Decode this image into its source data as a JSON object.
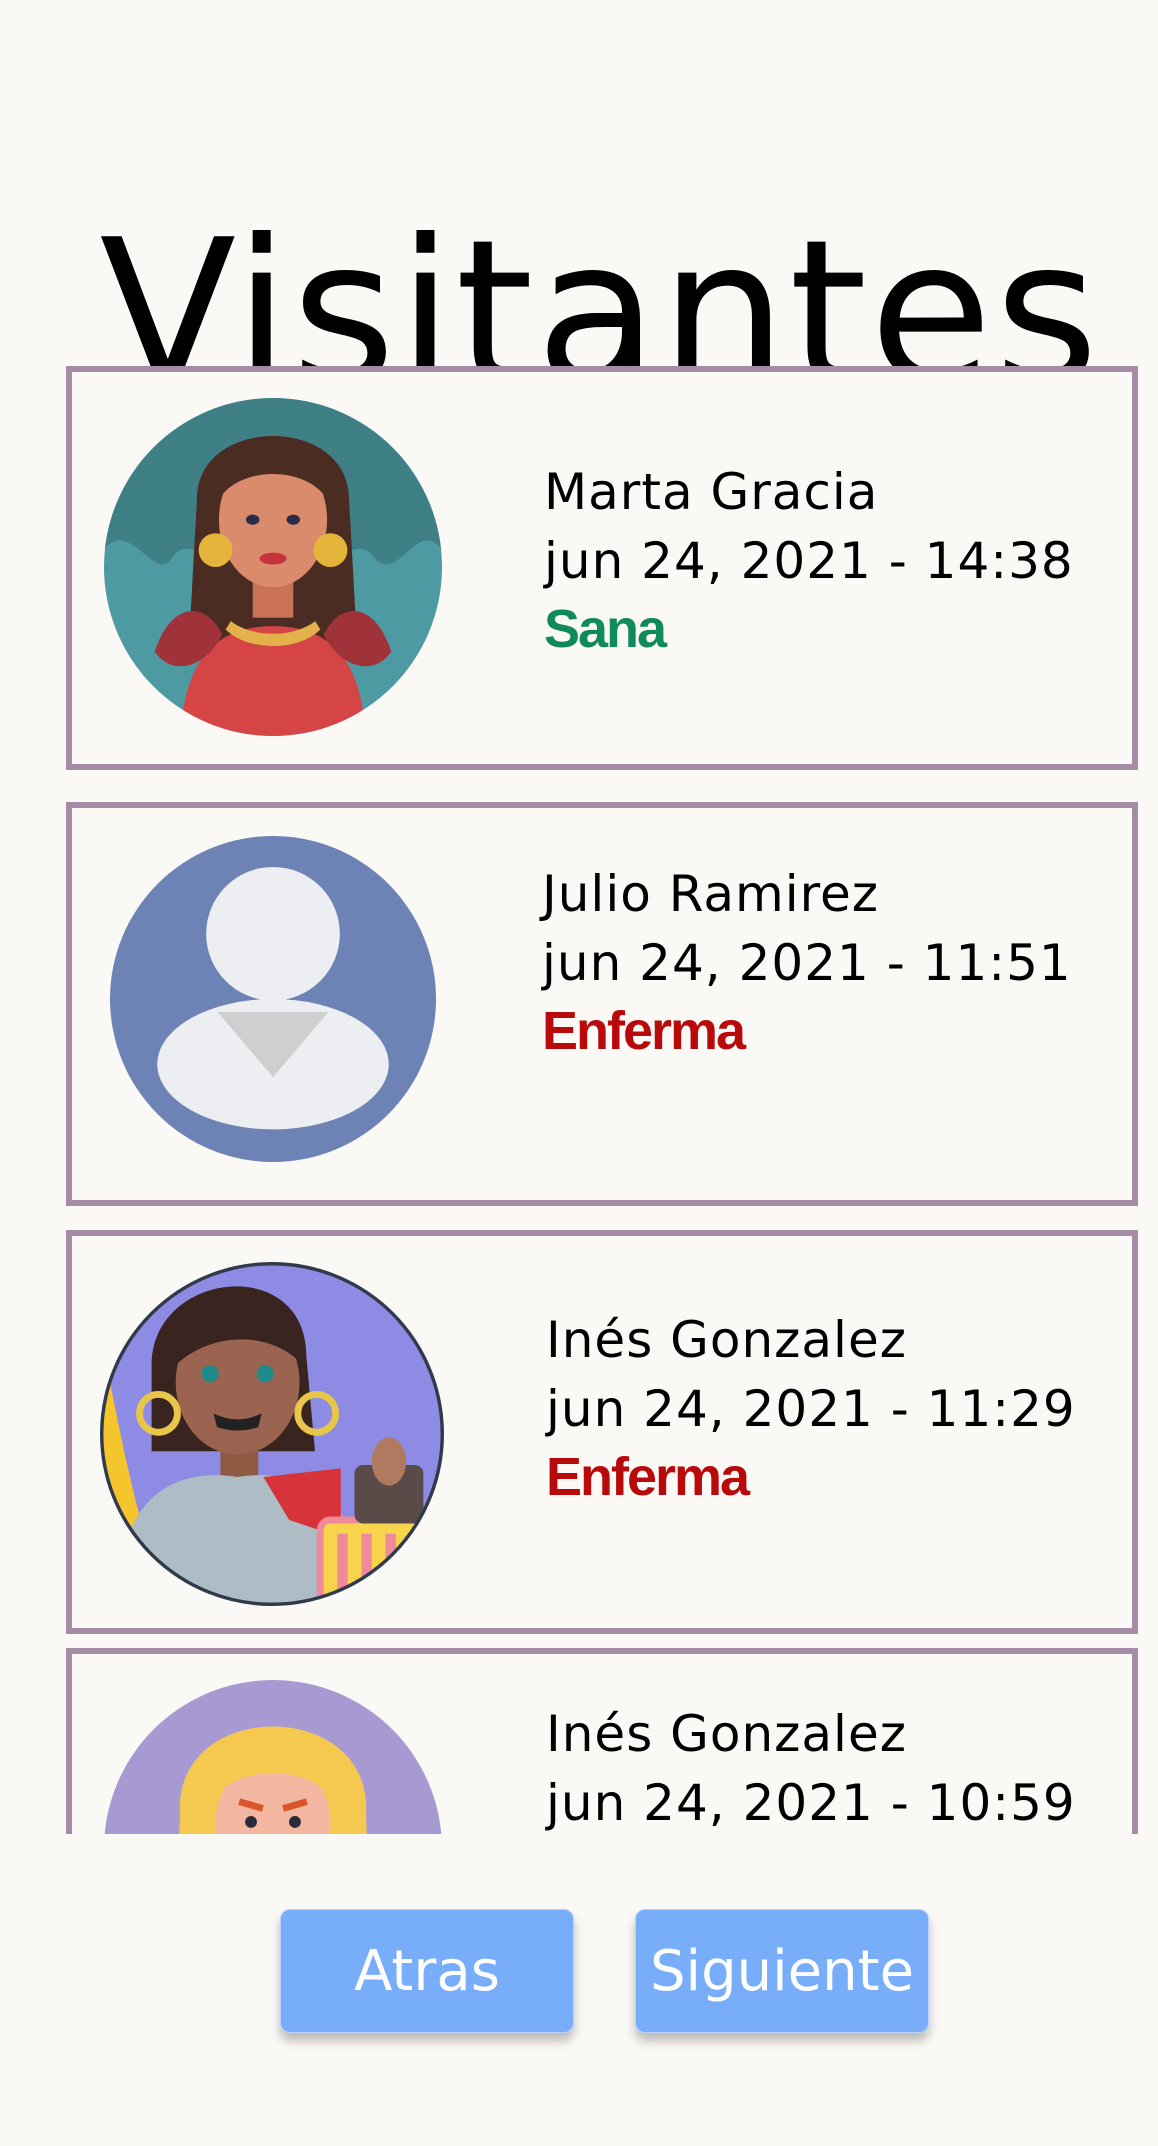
{
  "page": {
    "title": "Visitantes"
  },
  "visitors": [
    {
      "name": "Marta Gracia",
      "datetime": "jun 24, 2021 - 14:38",
      "status": "Sana",
      "avatar_icon": "woman-red-dress-avatar-icon"
    },
    {
      "name": "Julio Ramirez",
      "datetime": "jun 24, 2021 - 11:51",
      "status": "Enferma",
      "avatar_icon": "default-user-avatar-icon"
    },
    {
      "name": "Inés Gonzalez",
      "datetime": "jun 24, 2021 - 11:29",
      "status": "Enferma",
      "avatar_icon": "woman-harp-avatar-icon"
    },
    {
      "name": "Inés Gonzalez",
      "datetime": "jun 24, 2021 - 10:59",
      "status": "",
      "avatar_icon": "blonde-woman-mask-avatar-icon"
    }
  ],
  "status_colors": {
    "Sana": "#108a5a",
    "Enferma": "#b80a0a"
  },
  "nav": {
    "back_label": "Atras",
    "next_label": "Siguiente"
  },
  "colors": {
    "card_border": "#a58ba6",
    "button": "#78adfa",
    "background": "#faf9f6"
  }
}
